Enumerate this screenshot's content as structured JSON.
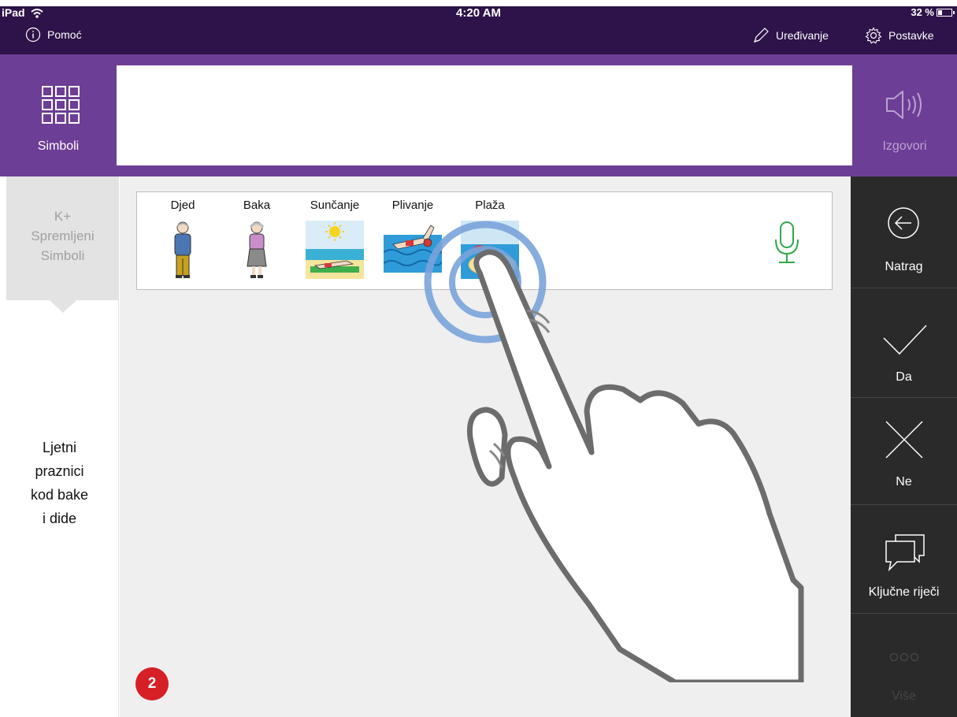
{
  "status_bar": {
    "device": "iPad",
    "time": "4:20 AM",
    "battery": "32 %",
    "help_label": "Pomoć",
    "edit_label": "Uređivanje",
    "settings_label": "Postavke"
  },
  "header": {
    "symbols_label": "Simboli",
    "speak_label": "Izgovori",
    "message_text": ""
  },
  "left_panel": {
    "saved_symbols_lines": [
      "K+",
      "Spremljeni",
      "Simboli"
    ],
    "story_title_lines": [
      "Ljetni",
      "praznici",
      "kod bake",
      "i dide"
    ]
  },
  "main": {
    "symbols": [
      {
        "label": "Djed",
        "icon": "grandfather-icon"
      },
      {
        "label": "Baka",
        "icon": "grandmother-icon"
      },
      {
        "label": "Sunčanje",
        "icon": "sunbathing-icon"
      },
      {
        "label": "Plivanje",
        "icon": "swimming-icon"
      },
      {
        "label": "Plaža",
        "icon": "beach-icon"
      }
    ],
    "page_badge": "2"
  },
  "right_rail": {
    "back_label": "Natrag",
    "yes_label": "Da",
    "no_label": "Ne",
    "keywords_label": "Ključne riječi",
    "more_label": "Više"
  },
  "colors": {
    "status_bar": "#2d1349",
    "header": "#6d3e96",
    "rail": "#2a2a2a",
    "badge": "#d71f26",
    "mic": "#2ea84a",
    "tap_ring": "#7aa3da"
  }
}
